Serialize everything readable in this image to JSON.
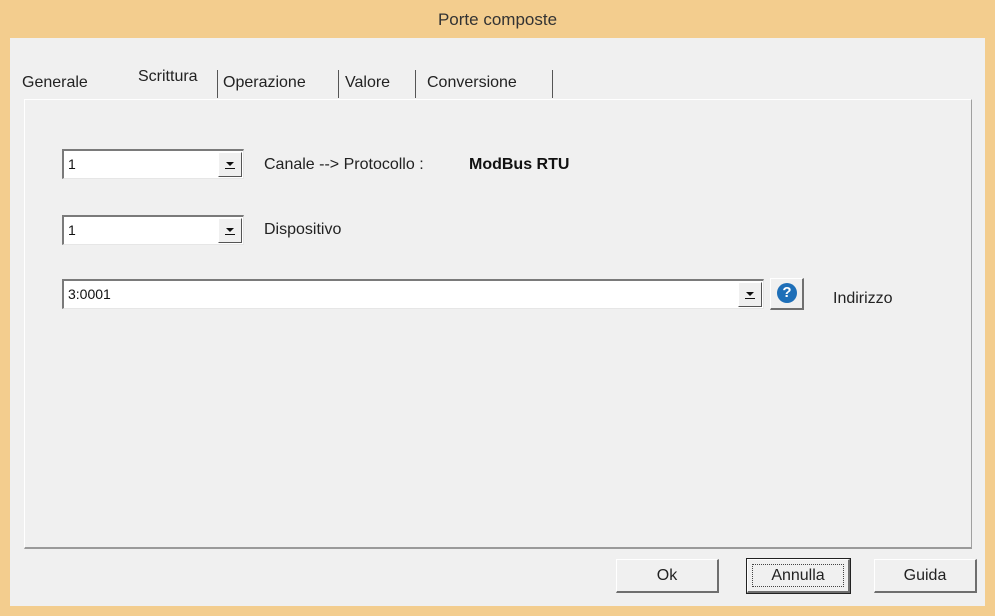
{
  "window": {
    "title": "Porte composte"
  },
  "tabs": [
    {
      "label": "Generale",
      "active": false
    },
    {
      "label": "Scrittura",
      "active": true
    },
    {
      "label": "Operazione",
      "active": false
    },
    {
      "label": "Valore",
      "active": false
    },
    {
      "label": "Conversione",
      "active": false
    }
  ],
  "channel": {
    "value": "1",
    "label": "Canale --> Protocollo :",
    "protocol": "ModBus RTU"
  },
  "device": {
    "value": "1",
    "label": "Dispositivo"
  },
  "address": {
    "value": "3:0001",
    "help_icon": "question-icon",
    "label": "Indirizzo"
  },
  "buttons": {
    "ok": "Ok",
    "cancel": "Annulla",
    "help": "Guida"
  },
  "colors": {
    "titlebar": "#f3cd8e",
    "client": "#f0f0f0",
    "help_icon": "#1e6fb8"
  }
}
